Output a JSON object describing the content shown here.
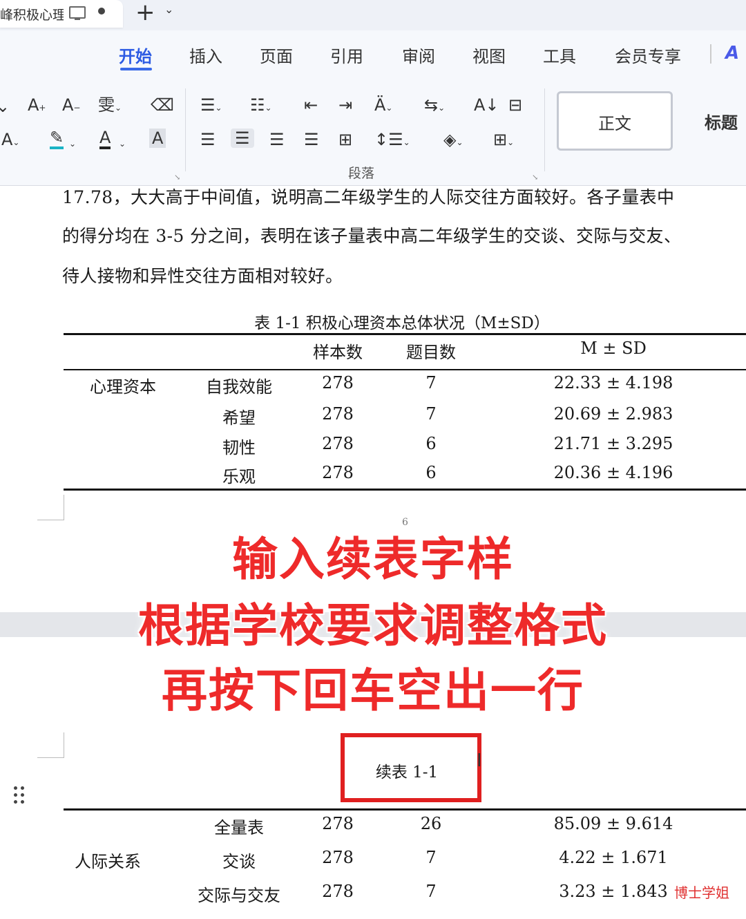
{
  "tab": {
    "title": "峰积极心理",
    "add_label": "+"
  },
  "menu": {
    "items": [
      "开始",
      "插入",
      "页面",
      "引用",
      "审阅",
      "视图",
      "工具",
      "会员专享"
    ],
    "active": "开始",
    "brand_icon": "wps-ai-icon"
  },
  "toolbar": {
    "font_group": [
      "font-grow-icon",
      "font-shrink-icon",
      "phonetic-guide-icon",
      "clear-format-icon",
      "text-effect-icon",
      "highlight-icon",
      "font-color-icon",
      "char-shading-icon"
    ],
    "paragraph_group": [
      "bullets-icon",
      "numbering-icon",
      "decrease-indent-icon",
      "increase-indent-icon",
      "chinese-layout-icon",
      "text-direction-icon",
      "sort-icon",
      "show-marks-icon",
      "align-left-icon",
      "align-center-icon",
      "align-right-icon",
      "justify-icon",
      "distribute-icon",
      "line-spacing-icon",
      "shading-icon",
      "borders-icon"
    ],
    "paragraph_group_label": "段落",
    "styles": {
      "normal": "正文",
      "heading": "标题"
    },
    "highlight_color": "#19b3c5",
    "font_color": "#222222"
  },
  "document": {
    "paragraph_lines": [
      "17.78，大大高于中间值，说明高二年级学生的人际交往方面较好。各子量表中",
      "的得分均在 3-5 分之间，表明在该子量表中高二年级学生的交谈、交际与交友、",
      "待人接物和异性交往方面相对较好。"
    ],
    "table_title": "表 1-1 积极心理资本总体状况（M±SD）",
    "table_headers": [
      "样本数",
      "题目数",
      "M ± SD"
    ],
    "table_group": "心理资本",
    "table_rows": [
      {
        "name": "自我效能",
        "n": "278",
        "items": "7",
        "msd": "22.33 ± 4.198"
      },
      {
        "name": "希望",
        "n": "278",
        "items": "7",
        "msd": "20.69 ± 2.983"
      },
      {
        "name": "韧性",
        "n": "278",
        "items": "6",
        "msd": "21.71 ± 3.295"
      },
      {
        "name": "乐观",
        "n": "278",
        "items": "6",
        "msd": "20.36 ± 4.196"
      }
    ],
    "page_number": "6",
    "continued_caption": "续表 1-1",
    "continued_group": "人际关系",
    "continued_rows": [
      {
        "name": "全量表",
        "n": "278",
        "items": "26",
        "msd": "85.09 ± 9.614"
      },
      {
        "name": "交谈",
        "n": "278",
        "items": "7",
        "msd": "4.22 ± 1.671"
      },
      {
        "name": "交际与交友",
        "n": "278",
        "items": "7",
        "msd": "3.23 ± 1.843"
      }
    ],
    "caption_highlight_color": "#e02020"
  },
  "overlay": {
    "lines": [
      "输入续表字样",
      "根据学校要求调整格式",
      "再按下回车空出一行"
    ],
    "color": "#ee2a2a"
  },
  "watermark": "博士学姐"
}
